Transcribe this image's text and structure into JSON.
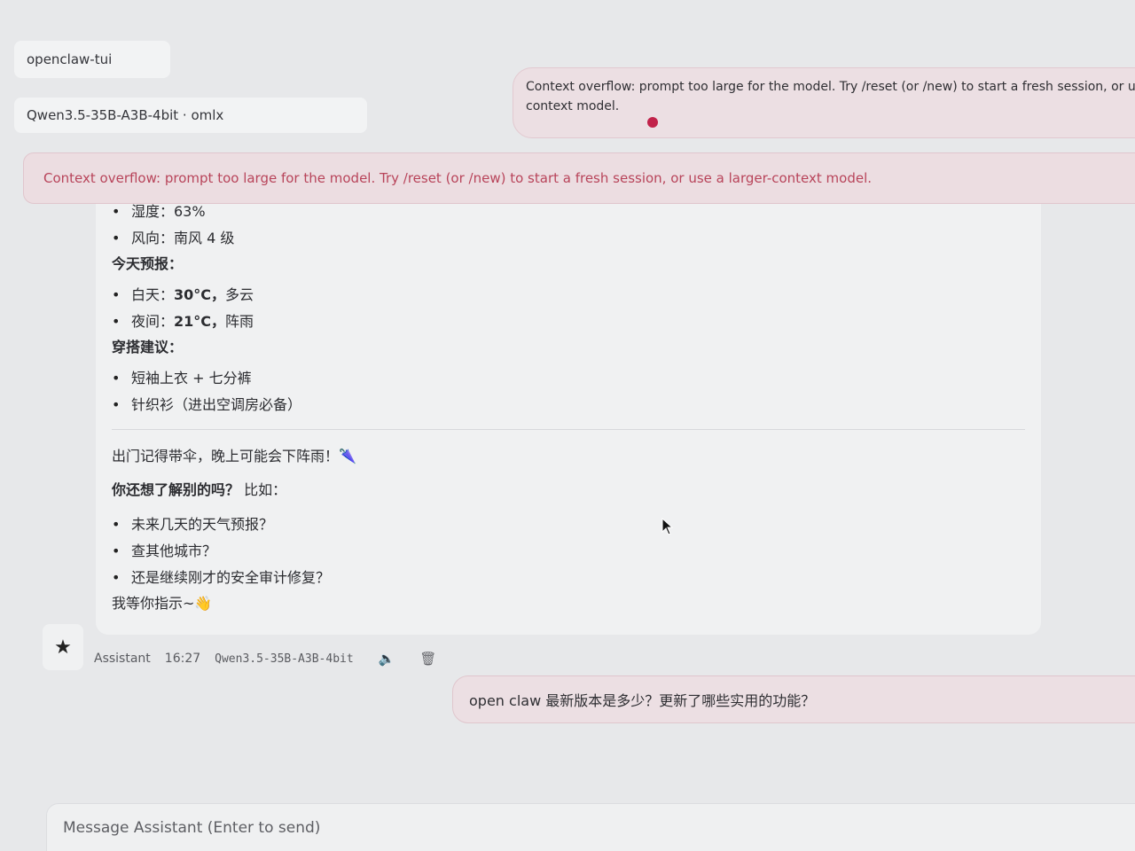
{
  "session": {
    "name": "openclaw-tui"
  },
  "model_selector": {
    "label": "Qwen3.5-35B-A3B-4bit · omlx"
  },
  "overflow_notice": {
    "text": "Context overflow: prompt too large for the model. Try /reset (or /new) to start a fresh session, or use a la",
    "text_line2": "context model."
  },
  "error_banner": {
    "text": "Context overflow: prompt too large for the model. Try /reset (or /new) to start a fresh session, or use a larger-context model."
  },
  "assistant_message": {
    "current_items": [
      "湿度：63%",
      "风向：南风 4 级"
    ],
    "forecast_heading": "今天预报：",
    "forecast_items": [
      {
        "label": "白天：",
        "value": "30°C，",
        "desc": "多云"
      },
      {
        "label": "夜间：",
        "value": "21°C，",
        "desc": "阵雨"
      }
    ],
    "outfit_heading": "穿搭建议：",
    "outfit_items": [
      "短袖上衣 + 七分裤",
      "针织衫（进出空调房必备）"
    ],
    "reminder": "出门记得带伞，晚上可能会下阵雨！🌂",
    "followup_bold": "你还想了解别的吗？",
    "followup_rest": " 比如：",
    "followup_items": [
      "未来几天的天气预报？",
      "查其他城市？",
      "还是继续刚才的安全审计修复？"
    ],
    "closing": "我等你指示~👋"
  },
  "message_meta": {
    "sender": "Assistant",
    "time": "16:27",
    "model": "Qwen3.5-35B-A3B-4bit"
  },
  "user_message": {
    "text": "open claw 最新版本是多少？更新了哪些实用的功能？"
  },
  "composer": {
    "placeholder": "Message Assistant (Enter to send)"
  },
  "icons": {
    "star": "star-icon",
    "speaker": "speaker-icon",
    "trash": "trash-icon"
  },
  "colors": {
    "error_text": "#b8445a",
    "error_bg": "#ecdde1",
    "user_bubble_bg": "#ecdfe3",
    "indicator_dot": "#c1224a"
  }
}
